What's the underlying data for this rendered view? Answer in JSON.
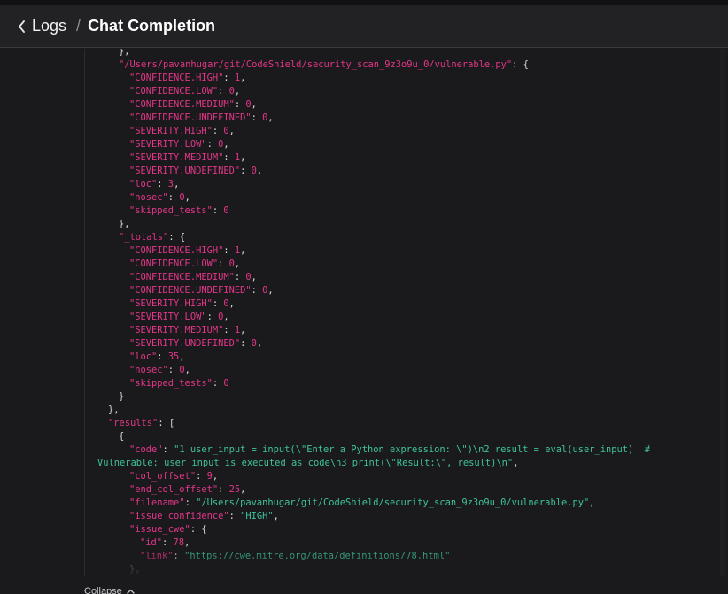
{
  "header": {
    "back_label": "Logs",
    "separator": "/",
    "title": "Chat Completion"
  },
  "collapse_label": "Collapse",
  "code_lines": [
    {
      "indent": 134,
      "tokens": [
        {
          "t": "p",
          "v": "},"
        }
      ]
    },
    {
      "indent": 134,
      "tokens": [
        {
          "t": "k",
          "v": "\"/Users/pavanhugar/git/CodeShield/security_scan_9z3o9u_0/vulnerable.py\""
        },
        {
          "t": "p",
          "v": ": {"
        }
      ]
    },
    {
      "indent": 146,
      "tokens": [
        {
          "t": "k",
          "v": "\"CONFIDENCE.HIGH\""
        },
        {
          "t": "p",
          "v": ": "
        },
        {
          "t": "n",
          "v": "1"
        },
        {
          "t": "p",
          "v": ","
        }
      ]
    },
    {
      "indent": 146,
      "tokens": [
        {
          "t": "k",
          "v": "\"CONFIDENCE.LOW\""
        },
        {
          "t": "p",
          "v": ": "
        },
        {
          "t": "n",
          "v": "0"
        },
        {
          "t": "p",
          "v": ","
        }
      ]
    },
    {
      "indent": 146,
      "tokens": [
        {
          "t": "k",
          "v": "\"CONFIDENCE.MEDIUM\""
        },
        {
          "t": "p",
          "v": ": "
        },
        {
          "t": "n",
          "v": "0"
        },
        {
          "t": "p",
          "v": ","
        }
      ]
    },
    {
      "indent": 146,
      "tokens": [
        {
          "t": "k",
          "v": "\"CONFIDENCE.UNDEFINED\""
        },
        {
          "t": "p",
          "v": ": "
        },
        {
          "t": "n",
          "v": "0"
        },
        {
          "t": "p",
          "v": ","
        }
      ]
    },
    {
      "indent": 146,
      "tokens": [
        {
          "t": "k",
          "v": "\"SEVERITY.HIGH\""
        },
        {
          "t": "p",
          "v": ": "
        },
        {
          "t": "n",
          "v": "0"
        },
        {
          "t": "p",
          "v": ","
        }
      ]
    },
    {
      "indent": 146,
      "tokens": [
        {
          "t": "k",
          "v": "\"SEVERITY.LOW\""
        },
        {
          "t": "p",
          "v": ": "
        },
        {
          "t": "n",
          "v": "0"
        },
        {
          "t": "p",
          "v": ","
        }
      ]
    },
    {
      "indent": 146,
      "tokens": [
        {
          "t": "k",
          "v": "\"SEVERITY.MEDIUM\""
        },
        {
          "t": "p",
          "v": ": "
        },
        {
          "t": "n",
          "v": "1"
        },
        {
          "t": "p",
          "v": ","
        }
      ]
    },
    {
      "indent": 146,
      "tokens": [
        {
          "t": "k",
          "v": "\"SEVERITY.UNDEFINED\""
        },
        {
          "t": "p",
          "v": ": "
        },
        {
          "t": "n",
          "v": "0"
        },
        {
          "t": "p",
          "v": ","
        }
      ]
    },
    {
      "indent": 146,
      "tokens": [
        {
          "t": "k",
          "v": "\"loc\""
        },
        {
          "t": "p",
          "v": ": "
        },
        {
          "t": "n",
          "v": "3"
        },
        {
          "t": "p",
          "v": ","
        }
      ]
    },
    {
      "indent": 146,
      "tokens": [
        {
          "t": "k",
          "v": "\"nosec\""
        },
        {
          "t": "p",
          "v": ": "
        },
        {
          "t": "n",
          "v": "0"
        },
        {
          "t": "p",
          "v": ","
        }
      ]
    },
    {
      "indent": 146,
      "tokens": [
        {
          "t": "k",
          "v": "\"skipped_tests\""
        },
        {
          "t": "p",
          "v": ": "
        },
        {
          "t": "n",
          "v": "0"
        }
      ]
    },
    {
      "indent": 134,
      "tokens": [
        {
          "t": "p",
          "v": "},"
        }
      ]
    },
    {
      "indent": 134,
      "tokens": [
        {
          "t": "k",
          "v": "\"_totals\""
        },
        {
          "t": "p",
          "v": ": {"
        }
      ]
    },
    {
      "indent": 146,
      "tokens": [
        {
          "t": "k",
          "v": "\"CONFIDENCE.HIGH\""
        },
        {
          "t": "p",
          "v": ": "
        },
        {
          "t": "n",
          "v": "1"
        },
        {
          "t": "p",
          "v": ","
        }
      ]
    },
    {
      "indent": 146,
      "tokens": [
        {
          "t": "k",
          "v": "\"CONFIDENCE.LOW\""
        },
        {
          "t": "p",
          "v": ": "
        },
        {
          "t": "n",
          "v": "0"
        },
        {
          "t": "p",
          "v": ","
        }
      ]
    },
    {
      "indent": 146,
      "tokens": [
        {
          "t": "k",
          "v": "\"CONFIDENCE.MEDIUM\""
        },
        {
          "t": "p",
          "v": ": "
        },
        {
          "t": "n",
          "v": "0"
        },
        {
          "t": "p",
          "v": ","
        }
      ]
    },
    {
      "indent": 146,
      "tokens": [
        {
          "t": "k",
          "v": "\"CONFIDENCE.UNDEFINED\""
        },
        {
          "t": "p",
          "v": ": "
        },
        {
          "t": "n",
          "v": "0"
        },
        {
          "t": "p",
          "v": ","
        }
      ]
    },
    {
      "indent": 146,
      "tokens": [
        {
          "t": "k",
          "v": "\"SEVERITY.HIGH\""
        },
        {
          "t": "p",
          "v": ": "
        },
        {
          "t": "n",
          "v": "0"
        },
        {
          "t": "p",
          "v": ","
        }
      ]
    },
    {
      "indent": 146,
      "tokens": [
        {
          "t": "k",
          "v": "\"SEVERITY.LOW\""
        },
        {
          "t": "p",
          "v": ": "
        },
        {
          "t": "n",
          "v": "0"
        },
        {
          "t": "p",
          "v": ","
        }
      ]
    },
    {
      "indent": 146,
      "tokens": [
        {
          "t": "k",
          "v": "\"SEVERITY.MEDIUM\""
        },
        {
          "t": "p",
          "v": ": "
        },
        {
          "t": "n",
          "v": "1"
        },
        {
          "t": "p",
          "v": ","
        }
      ]
    },
    {
      "indent": 146,
      "tokens": [
        {
          "t": "k",
          "v": "\"SEVERITY.UNDEFINED\""
        },
        {
          "t": "p",
          "v": ": "
        },
        {
          "t": "n",
          "v": "0"
        },
        {
          "t": "p",
          "v": ","
        }
      ]
    },
    {
      "indent": 146,
      "tokens": [
        {
          "t": "k",
          "v": "\"loc\""
        },
        {
          "t": "p",
          "v": ": "
        },
        {
          "t": "n",
          "v": "35"
        },
        {
          "t": "p",
          "v": ","
        }
      ]
    },
    {
      "indent": 146,
      "tokens": [
        {
          "t": "k",
          "v": "\"nosec\""
        },
        {
          "t": "p",
          "v": ": "
        },
        {
          "t": "n",
          "v": "0"
        },
        {
          "t": "p",
          "v": ","
        }
      ]
    },
    {
      "indent": 146,
      "tokens": [
        {
          "t": "k",
          "v": "\"skipped_tests\""
        },
        {
          "t": "p",
          "v": ": "
        },
        {
          "t": "n",
          "v": "0"
        }
      ]
    },
    {
      "indent": 134,
      "tokens": [
        {
          "t": "p",
          "v": "}"
        }
      ]
    },
    {
      "indent": 122,
      "tokens": [
        {
          "t": "p",
          "v": "},"
        }
      ]
    },
    {
      "indent": 122,
      "tokens": [
        {
          "t": "k",
          "v": "\"results\""
        },
        {
          "t": "p",
          "v": ": ["
        }
      ]
    },
    {
      "indent": 134,
      "tokens": [
        {
          "t": "p",
          "v": "{"
        }
      ]
    },
    {
      "indent": 146,
      "tokens": [
        {
          "t": "k",
          "v": "\"code\""
        },
        {
          "t": "p",
          "v": ": "
        },
        {
          "t": "s",
          "v": "\"1 user_input = input(\\\"Enter a Python expression: \\\")\\n2 result = eval(user_input)  #"
        }
      ]
    },
    {
      "indent": 110,
      "tokens": [
        {
          "t": "s",
          "v": "Vulnerable: user input is executed as code\\n3 print(\\\"Result:\\\", result)\\n\""
        },
        {
          "t": "p",
          "v": ","
        }
      ]
    },
    {
      "indent": 146,
      "tokens": [
        {
          "t": "k",
          "v": "\"col_offset\""
        },
        {
          "t": "p",
          "v": ": "
        },
        {
          "t": "n",
          "v": "9"
        },
        {
          "t": "p",
          "v": ","
        }
      ]
    },
    {
      "indent": 146,
      "tokens": [
        {
          "t": "k",
          "v": "\"end_col_offset\""
        },
        {
          "t": "p",
          "v": ": "
        },
        {
          "t": "n",
          "v": "25"
        },
        {
          "t": "p",
          "v": ","
        }
      ]
    },
    {
      "indent": 146,
      "tokens": [
        {
          "t": "k",
          "v": "\"filename\""
        },
        {
          "t": "p",
          "v": ": "
        },
        {
          "t": "s",
          "v": "\"/Users/pavanhugar/git/CodeShield/security_scan_9z3o9u_0/vulnerable.py\""
        },
        {
          "t": "p",
          "v": ","
        }
      ]
    },
    {
      "indent": 146,
      "tokens": [
        {
          "t": "k",
          "v": "\"issue_confidence\""
        },
        {
          "t": "p",
          "v": ": "
        },
        {
          "t": "s",
          "v": "\"HIGH\""
        },
        {
          "t": "p",
          "v": ","
        }
      ]
    },
    {
      "indent": 146,
      "tokens": [
        {
          "t": "k",
          "v": "\"issue_cwe\""
        },
        {
          "t": "p",
          "v": ": {"
        }
      ]
    },
    {
      "indent": 158,
      "tokens": [
        {
          "t": "k",
          "v": "\"id\""
        },
        {
          "t": "p",
          "v": ": "
        },
        {
          "t": "n",
          "v": "78"
        },
        {
          "t": "p",
          "v": ","
        }
      ]
    },
    {
      "indent": 158,
      "tokens": [
        {
          "t": "k",
          "v": "\"link\""
        },
        {
          "t": "p",
          "v": ": "
        },
        {
          "t": "s",
          "v": "\"https://cwe.mitre.org/data/definitions/78.html\""
        }
      ]
    },
    {
      "indent": 146,
      "tokens": [
        {
          "t": "p",
          "v": "},"
        }
      ]
    }
  ]
}
